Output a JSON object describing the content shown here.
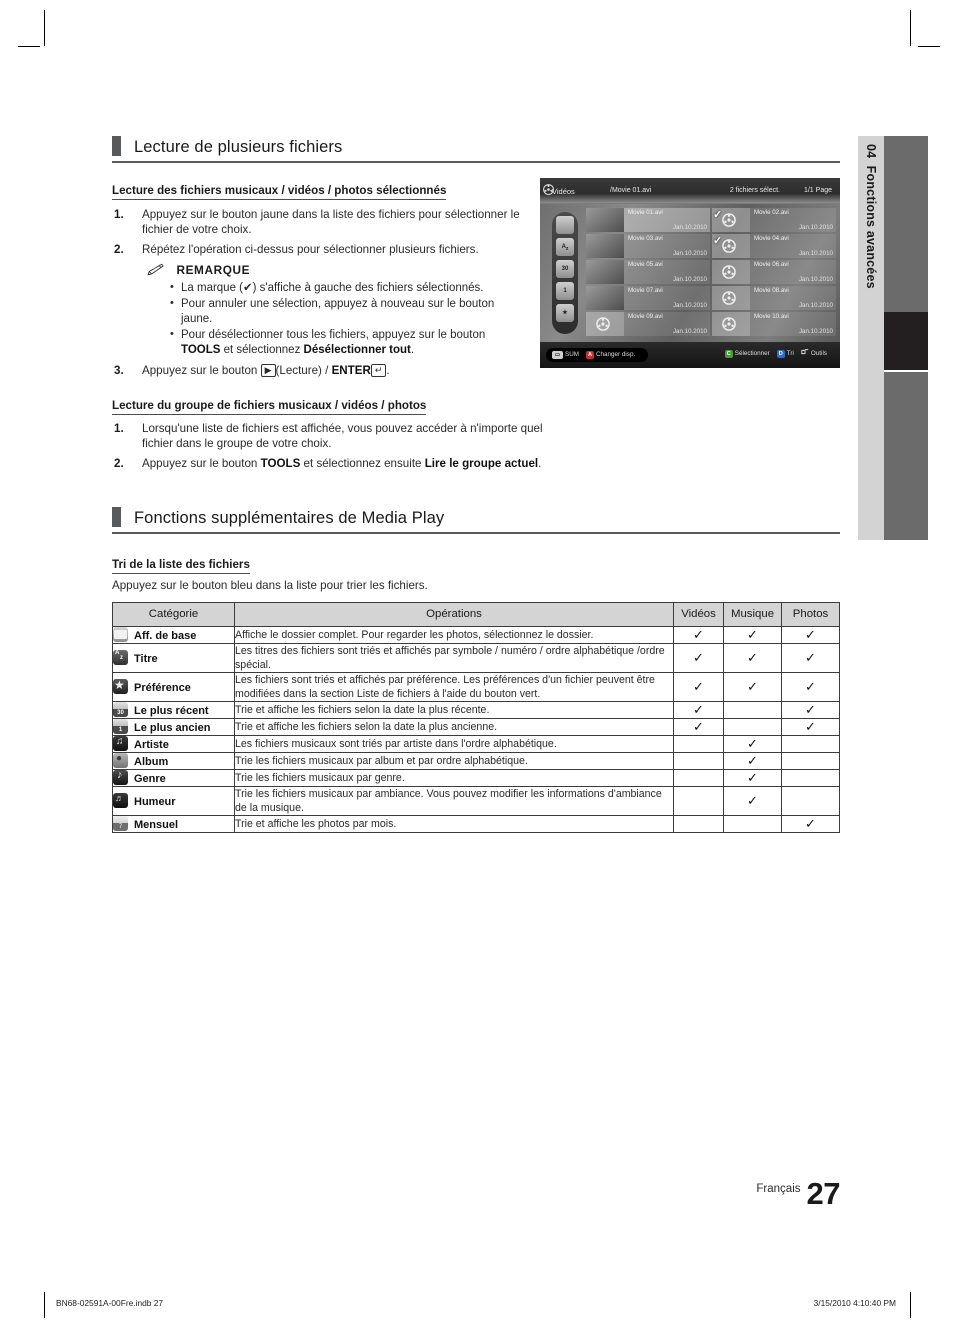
{
  "chapter_tab": {
    "number": "04",
    "label": "Fonctions avancées"
  },
  "sections": [
    {
      "title": "Lecture de plusieurs fichiers",
      "sub1": "Lecture des fichiers musicaux / vidéos / photos sélectionnés",
      "step1": "Appuyez sur le bouton jaune dans la liste des fichiers pour sélectionner le fichier de votre choix.",
      "step1_num": "1.",
      "step2": "Répétez l'opération ci-dessus pour sélectionner plusieurs fichiers.",
      "step2_num": "2.",
      "note_title": "REMARQUE",
      "bullet1": "La marque (✔) s'affiche à gauche des fichiers sélectionnés.",
      "bullet2": "Pour annuler une sélection, appuyez à nouveau sur le bouton jaune.",
      "bullet3_pre": "Pour désélectionner tous les fichiers, appuyez sur le bouton ",
      "bullet3_tools": "TOOLS",
      "bullet3_mid": " et sélectionnez ",
      "bullet3_bold": "Désélectionner tout",
      "bullet3_end": ".",
      "step3_num": "3.",
      "step3_pre": "Appuyez sur le bouton ",
      "step3_play_key": "▶",
      "step3_mid": "(Lecture) / ",
      "step3_enter": "ENTER",
      "step3_enter_key": "↵",
      "step3_end": ".",
      "sub2": "Lecture du groupe de fichiers musicaux / vidéos / photos",
      "g_step1_num": "1.",
      "g_step1": "Lorsqu'une liste de fichiers est affichée, vous pouvez accéder à n'importe quel fichier dans le groupe de votre choix.",
      "g_step2_num": "2.",
      "g_step2_pre": "Appuyez sur le bouton ",
      "g_step2_tools": "TOOLS",
      "g_step2_mid": " et sélectionnez ensuite ",
      "g_step2_bold": "Lire le groupe actuel",
      "g_step2_end": "."
    },
    {
      "title": "Fonctions supplémentaires de Media Play",
      "sub1": "Tri de la liste des fichiers",
      "intro": "Appuyez sur le bouton bleu dans la liste pour trier les fichiers."
    }
  ],
  "tv_screen": {
    "source_label": "Vidéos",
    "path": "/Movie 01.avi",
    "status": "2 fichiers sélect.",
    "page": "1/1 Page",
    "side_icons": [
      "folder-icon",
      "az-sort-icon",
      "calendar-30-icon",
      "calendar-1-icon",
      "star-icon"
    ],
    "left_column": [
      {
        "name": "Movie 01.avi",
        "date": "Jan.10.2010",
        "selected": true,
        "checked": false,
        "thumb": true
      },
      {
        "name": "Movie 03.avi",
        "date": "Jan.10.2010",
        "selected": false,
        "checked": false,
        "thumb": true
      },
      {
        "name": "Movie 05.avi",
        "date": "Jan.10.2010",
        "selected": false,
        "checked": false,
        "thumb": true
      },
      {
        "name": "Movie 07.avi",
        "date": "Jan.10.2010",
        "selected": false,
        "checked": false,
        "thumb": true
      },
      {
        "name": "Movie 09.avi",
        "date": "Jan.10.2010",
        "selected": false,
        "checked": false,
        "thumb": false
      }
    ],
    "right_column": [
      {
        "name": "Movie 02.avi",
        "date": "Jan.10.2010",
        "selected": false,
        "checked": true,
        "thumb": false
      },
      {
        "name": "Movie 04.avi",
        "date": "Jan.10.2010",
        "selected": false,
        "checked": true,
        "thumb": false
      },
      {
        "name": "Movie 06.avi",
        "date": "Jan.10.2010",
        "selected": false,
        "checked": false,
        "thumb": false
      },
      {
        "name": "Movie 08.avi",
        "date": "Jan.10.2010",
        "selected": false,
        "checked": false,
        "thumb": false
      },
      {
        "name": "Movie 10.avi",
        "date": "Jan.10.2010",
        "selected": false,
        "checked": false,
        "thumb": false
      }
    ],
    "footer_left": [
      {
        "key": "usb-icon",
        "label": "SUM"
      },
      {
        "key": "A",
        "label": "Changer disp."
      }
    ],
    "footer_right": [
      {
        "key": "C",
        "label": "Sélectionner"
      },
      {
        "key": "D",
        "label": "Tri"
      },
      {
        "key": "tools-icon",
        "label": "Outils"
      }
    ],
    "check_mark": "✓"
  },
  "sort_table": {
    "headers": [
      "Catégorie",
      "Opérations",
      "Vidéos",
      "Musique",
      "Photos"
    ],
    "mark": "✓",
    "rows": [
      {
        "icon": "folder-icon",
        "category": "Aff. de base",
        "operation": "Affiche le dossier complet. Pour regarder les photos, sélectionnez le dossier.",
        "videos": true,
        "music": true,
        "photos": true
      },
      {
        "icon": "az-sort-icon",
        "category": "Titre",
        "operation": "Les titres des fichiers sont triés et affichés par symbole / numéro / ordre alphabétique /ordre spécial.",
        "videos": true,
        "music": true,
        "photos": true
      },
      {
        "icon": "star-icon",
        "category": "Préférence",
        "operation": "Les fichiers sont triés et affichés par préférence. Les préférences d'un fichier peuvent être modifiées dans la section Liste de fichiers à l'aide du bouton vert.",
        "videos": true,
        "music": true,
        "photos": true
      },
      {
        "icon": "calendar-30-icon",
        "category": "Le plus récent",
        "operation": "Trie et affiche les fichiers selon la date la plus récente.",
        "videos": true,
        "music": false,
        "photos": true
      },
      {
        "icon": "calendar-1-icon",
        "category": "Le plus ancien",
        "operation": "Trie et affiche les fichiers selon la date la plus ancienne.",
        "videos": true,
        "music": false,
        "photos": true
      },
      {
        "icon": "artist-icon",
        "category": "Artiste",
        "operation": "Les fichiers musicaux sont triés par artiste dans l'ordre alphabétique.",
        "videos": false,
        "music": true,
        "photos": false
      },
      {
        "icon": "album-icon",
        "category": "Album",
        "operation": "Trie les fichiers musicaux par album et par ordre alphabétique.",
        "videos": false,
        "music": true,
        "photos": false
      },
      {
        "icon": "genre-icon",
        "category": "Genre",
        "operation": "Trie les fichiers musicaux par genre.",
        "videos": false,
        "music": true,
        "photos": false
      },
      {
        "icon": "mood-icon",
        "category": "Humeur",
        "operation": "Trie les fichiers musicaux par ambiance. Vous pouvez modifier les informations d'ambiance de la musique.",
        "videos": false,
        "music": true,
        "photos": false
      },
      {
        "icon": "month-icon",
        "category": "Mensuel",
        "operation": "Trie et affiche les photos par mois.",
        "videos": false,
        "music": false,
        "photos": true
      }
    ]
  },
  "page_footer": {
    "language": "Français",
    "page_number": "27"
  },
  "doc_footer": {
    "file": "BN68-02591A-00Fre.indb   27",
    "timestamp": "3/15/2010   4:10:40 PM"
  }
}
